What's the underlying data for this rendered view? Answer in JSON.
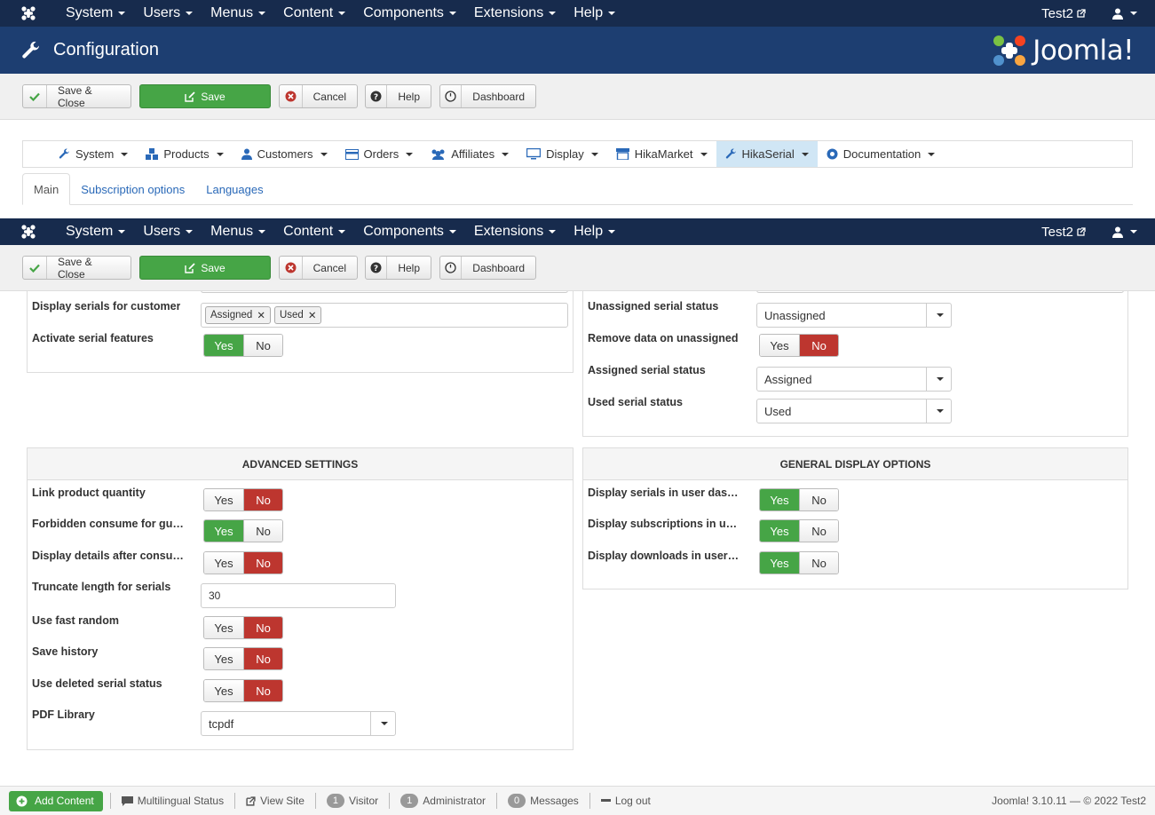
{
  "topnav": {
    "items": [
      "System",
      "Users",
      "Menus",
      "Content",
      "Components",
      "Extensions",
      "Help"
    ],
    "site": "Test2"
  },
  "header": {
    "title": "Configuration",
    "brand": "Joomla!"
  },
  "toolbar": {
    "save_close": "Save & Close",
    "save": "Save",
    "cancel": "Cancel",
    "help": "Help",
    "dashboard": "Dashboard"
  },
  "hikamenu": {
    "items": [
      "System",
      "Products",
      "Customers",
      "Orders",
      "Affiliates",
      "Display",
      "HikaMarket",
      "HikaSerial",
      "Documentation"
    ]
  },
  "tabs": [
    "Main",
    "Subscription options",
    "Languages"
  ],
  "left_top": {
    "display_serials_label": "Display serials for customer",
    "tags": [
      "Assigned",
      "Used"
    ],
    "activate_label": "Activate serial features",
    "yes": "Yes",
    "no": "No"
  },
  "right_top": {
    "unassigned_label": "Unassigned serial status",
    "unassigned_value": "Unassigned",
    "remove_label": "Remove data on unassigned",
    "assigned_label": "Assigned serial status",
    "assigned_value": "Assigned",
    "used_label": "Used serial status",
    "used_value": "Used"
  },
  "advanced": {
    "title": "ADVANCED SETTINGS",
    "link_qty": "Link product quantity",
    "forbidden": "Forbidden consume for gu…",
    "display_details": "Display details after consu…",
    "truncate": "Truncate length for serials",
    "truncate_value": "30",
    "fast_random": "Use fast random",
    "save_history": "Save history",
    "deleted_status": "Use deleted serial status",
    "pdf_lib": "PDF Library",
    "pdf_value": "tcpdf"
  },
  "general": {
    "title": "GENERAL DISPLAY OPTIONS",
    "serials_dash": "Display serials in user das…",
    "subs_dash": "Display subscriptions in u…",
    "downloads_dash": "Display downloads in user…"
  },
  "statusbar": {
    "add_content": "Add Content",
    "multilingual": "Multilingual Status",
    "view_site": "View Site",
    "visitor_count": "1",
    "visitor": "Visitor",
    "admin_count": "1",
    "admin": "Administrator",
    "messages_count": "0",
    "messages": "Messages",
    "logout": "Log out",
    "copyright": "Joomla! 3.10.11  —  © 2022 Test2"
  },
  "colors": {
    "navbar": "#172b4d",
    "header": "#1d3e71",
    "success": "#46a546",
    "danger": "#bd362f"
  }
}
